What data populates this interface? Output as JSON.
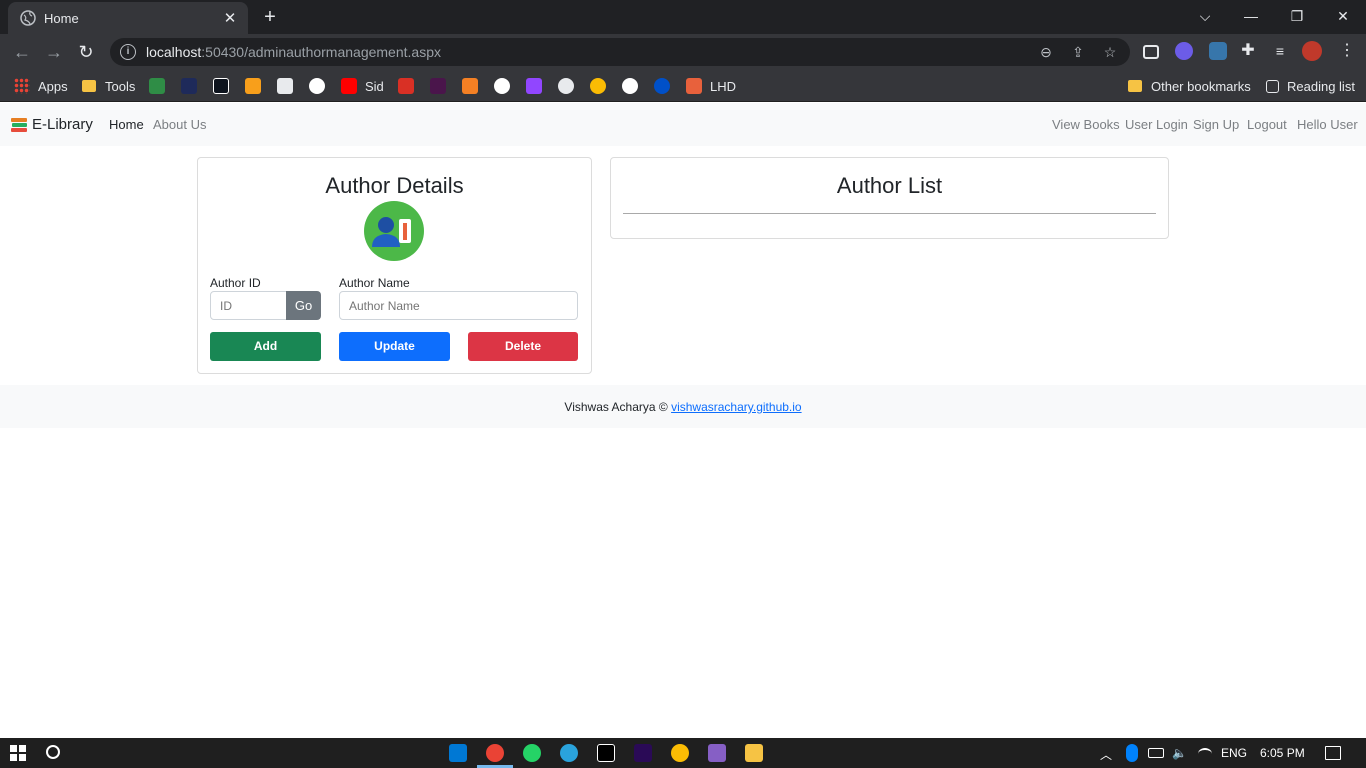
{
  "browser": {
    "tab_title": "Home",
    "tab_close": "✕",
    "new_tab": "+",
    "url_host": "localhost",
    "url_rest": ":50430/adminauthormanagement.aspx",
    "window_controls": [
      "⌵",
      "—",
      "❐",
      "✕"
    ]
  },
  "bookmarks": {
    "apps": "Apps",
    "tools": "Tools",
    "sid": "Sid",
    "lhd": "LHD",
    "other": "Other bookmarks",
    "reading_list": "Reading list"
  },
  "site_nav": {
    "brand": "E-Library",
    "left_links": [
      "Home",
      "About Us"
    ],
    "right_links": [
      "View Books",
      "User Login",
      "Sign Up",
      "Logout",
      "Hello User"
    ]
  },
  "author_details": {
    "title": "Author Details",
    "author_id_label": "Author ID",
    "author_id_placeholder": "ID",
    "go_label": "Go",
    "author_name_label": "Author Name",
    "author_name_placeholder": "Author Name",
    "add_label": "Add",
    "update_label": "Update",
    "delete_label": "Delete"
  },
  "author_list": {
    "title": "Author List"
  },
  "footer": {
    "text": "Vishwas Acharya © ",
    "link": "vishwasrachary.github.io"
  },
  "taskbar": {
    "language": "ENG",
    "time": "6:05 PM"
  },
  "colors": {
    "add": "#198754",
    "update": "#0d6efd",
    "delete": "#dc3545",
    "go": "#6c757d"
  }
}
